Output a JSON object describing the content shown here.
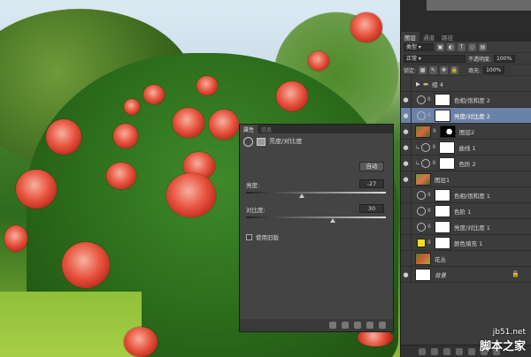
{
  "layers_panel": {
    "tabs": [
      "图层",
      "通道",
      "路径"
    ],
    "filter_label": "类型",
    "blend_mode": "正常",
    "opacity_label": "不透明度:",
    "opacity_value": "100%",
    "lock_label": "锁定:",
    "fill_label": "填充:",
    "fill_value": "100%",
    "layers": [
      {
        "name": "组 4",
        "kind": "group",
        "visible": false
      },
      {
        "name": "色相/饱和度 2",
        "kind": "adjustment",
        "visible": true
      },
      {
        "name": "亮度/对比度 2",
        "kind": "adjustment",
        "visible": true,
        "selected": true
      },
      {
        "name": "图层2",
        "kind": "pixel",
        "visible": true
      },
      {
        "name": "曲线 1",
        "kind": "adjustment",
        "visible": true
      },
      {
        "name": "色阶 2",
        "kind": "adjustment",
        "visible": true
      },
      {
        "name": "图层1",
        "kind": "pixel",
        "visible": true
      },
      {
        "name": "色相/饱和度 1",
        "kind": "adjustment",
        "visible": false
      },
      {
        "name": "色阶 1",
        "kind": "adjustment",
        "visible": false
      },
      {
        "name": "亮度/对比度 1",
        "kind": "adjustment",
        "visible": false
      },
      {
        "name": "颜色填充 1",
        "kind": "fill",
        "visible": false
      },
      {
        "name": "花丛",
        "kind": "pixel",
        "visible": false
      },
      {
        "name": "背景",
        "kind": "background",
        "visible": true
      }
    ]
  },
  "properties_panel": {
    "tabs": [
      "属性",
      "信息"
    ],
    "title": "亮度/对比度",
    "auto_label": "自动",
    "brightness_label": "亮度:",
    "brightness_value": "-27",
    "brightness_level": 0.4,
    "contrast_label": "对比度:",
    "contrast_value": "30",
    "contrast_level": 0.62,
    "legacy_label": "使用旧版"
  },
  "watermark": {
    "line1": "jb51.net",
    "line2": "脚本之家"
  },
  "colors": {
    "selected_layer": "#6b82a8",
    "panel_bg": "#3c3c3c",
    "fill_swatch": "#f2dc1a"
  }
}
